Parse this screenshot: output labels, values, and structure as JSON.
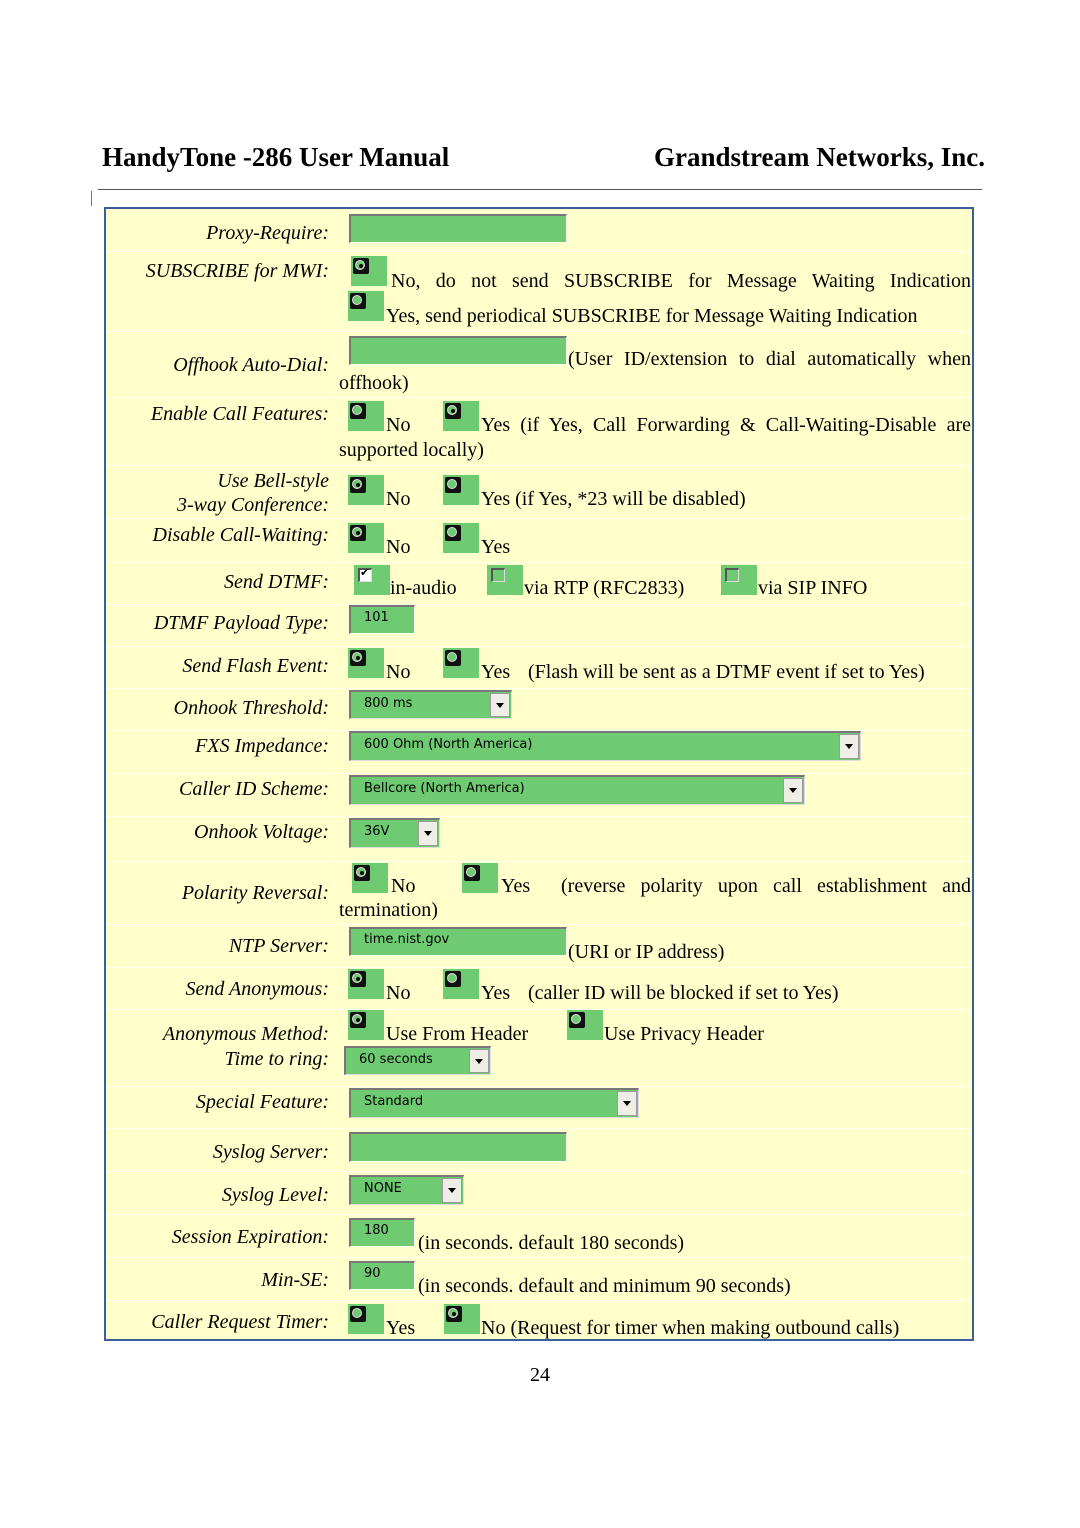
{
  "header": {
    "title_left": "HandyTone -286 User Manual",
    "title_right": "Grandstream Networks, Inc."
  },
  "page_number": "24",
  "colors": {
    "panel_bg": "#ffffcc",
    "field_green": "#6fcb72",
    "panel_border": "#3a5f9a"
  },
  "settings": {
    "proxy_require": {
      "label": "Proxy-Require:",
      "value": ""
    },
    "subscribe_mwi": {
      "label": "SUBSCRIBE for MWI:",
      "options": [
        "No, do not send SUBSCRIBE for Message Waiting Indication",
        "Yes, send periodical SUBSCRIBE for Message Waiting Indication"
      ],
      "selected": "No, do not send SUBSCRIBE for Message Waiting Indication"
    },
    "offhook_autodial": {
      "label": "Offhook Auto-Dial:",
      "value": "",
      "note": "(User ID/extension to dial automatically when",
      "note2": "offhook)"
    },
    "enable_call_features": {
      "label": "Enable Call Features:",
      "options": [
        "No",
        "Yes (if Yes, Call Forwarding & Call-Waiting-Disable are"
      ],
      "note2": "supported locally)",
      "selected": "Yes"
    },
    "bell_style": {
      "label1": "Use Bell-style",
      "label2": "3-way Conference:",
      "options": [
        "No",
        "Yes (if Yes, *23 will be disabled)"
      ],
      "selected": "No"
    },
    "disable_call_waiting": {
      "label": "Disable Call-Waiting:",
      "options": [
        "No",
        "Yes"
      ],
      "selected": "No"
    },
    "send_dtmf": {
      "label": "Send DTMF:",
      "options": [
        "in-audio",
        "via RTP (RFC2833)",
        "via SIP INFO"
      ],
      "checked": [
        "in-audio"
      ]
    },
    "dtmf_payload_type": {
      "label": "DTMF Payload Type:",
      "value": "101"
    },
    "send_flash_event": {
      "label": "Send Flash Event:",
      "options": [
        "No",
        "Yes"
      ],
      "note": "(Flash will be sent as a DTMF event if set to Yes)",
      "selected": "No"
    },
    "onhook_threshold": {
      "label": "Onhook Threshold:",
      "value": "800 ms"
    },
    "fxs_impedance": {
      "label": "FXS Impedance:",
      "value": "600 Ohm (North America)"
    },
    "caller_id_scheme": {
      "label": "Caller ID Scheme:",
      "value": "Bellcore (North America)"
    },
    "onhook_voltage": {
      "label": "Onhook Voltage:",
      "value": "36V"
    },
    "polarity_reversal": {
      "label": "Polarity Reversal:",
      "options": [
        "No",
        "Yes"
      ],
      "note": "(reverse polarity upon call establishment and",
      "note2": "termination)",
      "selected": "No"
    },
    "ntp_server": {
      "label": "NTP Server:",
      "value": "time.nist.gov",
      "note": "(URI or IP address)"
    },
    "send_anonymous": {
      "label": "Send Anonymous:",
      "options": [
        "No",
        "Yes"
      ],
      "note": "(caller ID will be blocked if set to Yes)",
      "selected": "No"
    },
    "anonymous_method": {
      "label": "Anonymous Method:",
      "options": [
        "Use From Header",
        "Use Privacy Header"
      ],
      "selected": "Use From Header"
    },
    "time_to_ring": {
      "label": "Time to ring:",
      "value": "60 seconds"
    },
    "special_feature": {
      "label": "Special Feature:",
      "value": "Standard"
    },
    "syslog_server": {
      "label": "Syslog Server:",
      "value": ""
    },
    "syslog_level": {
      "label": "Syslog Level:",
      "value": "NONE"
    },
    "session_expiration": {
      "label": "Session Expiration:",
      "value": "180",
      "note": "(in seconds. default 180 seconds)"
    },
    "min_se": {
      "label": "Min-SE:",
      "value": "90",
      "note": "(in seconds. default and minimum 90 seconds)"
    },
    "caller_request_timer": {
      "label": "Caller Request Timer:",
      "options": [
        "Yes",
        "No (Request for timer when making outbound calls)"
      ],
      "selected": "No"
    }
  }
}
